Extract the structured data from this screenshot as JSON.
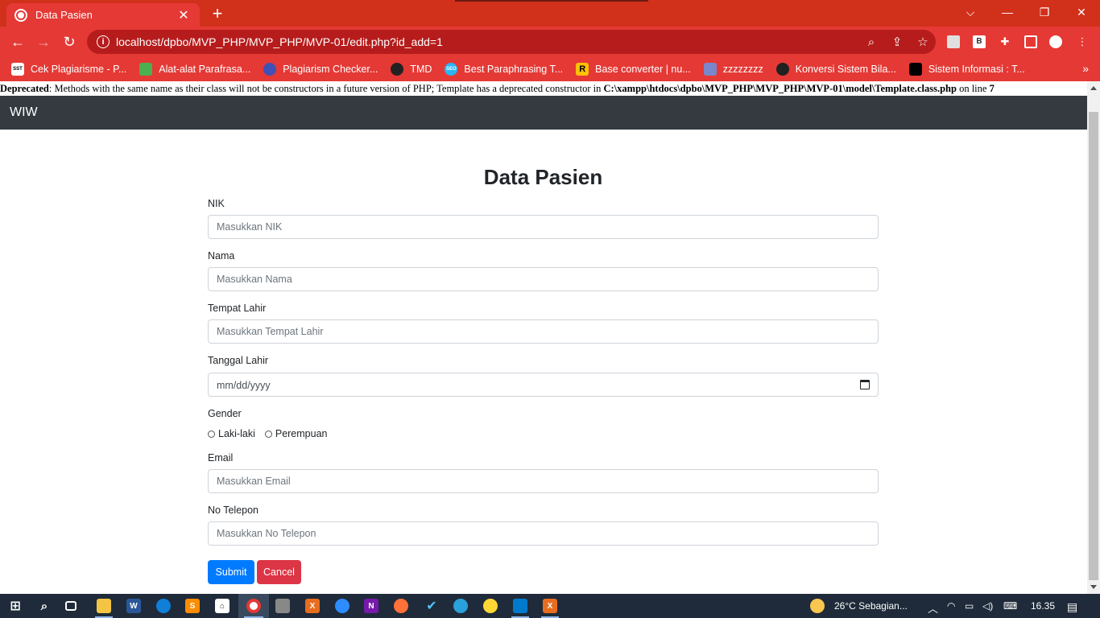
{
  "browser": {
    "tab_title": "Data Pasien",
    "tab_close": "✕",
    "new_tab": "+",
    "window_controls": [
      "⌵",
      "—",
      "❐",
      "✕"
    ],
    "url": "localhost/dpbo/MVP_PHP/MVP_PHP/MVP-01/edit.php?id_add=1",
    "nav": {
      "back": "←",
      "forward": "→",
      "reload": "↻"
    },
    "omnibox_icons": [
      "zoom-icon",
      "share-icon",
      "star-icon"
    ],
    "bookmarks": [
      {
        "label": "Cek Plagiarisme - P...",
        "icon": "SST",
        "color": "#ffffff"
      },
      {
        "label": "Alat-alat Parafrasa...",
        "icon": "",
        "color": "#4caf50"
      },
      {
        "label": "Plagiarism Checker...",
        "icon": "",
        "color": "#3f51b5"
      },
      {
        "label": "TMD",
        "icon": "",
        "color": "#222222"
      },
      {
        "label": "Best Paraphrasing T...",
        "icon": "SEO",
        "color": "#29b6f6"
      },
      {
        "label": "Base converter | nu...",
        "icon": "R",
        "color": "#ffc107"
      },
      {
        "label": "zzzzzzzz",
        "icon": "",
        "color": "#7986cb"
      },
      {
        "label": "Konversi Sistem Bila...",
        "icon": "",
        "color": "#212121"
      },
      {
        "label": "Sistem Informasi : T...",
        "icon": "",
        "color": "#000000"
      }
    ],
    "bookmarks_more": "»"
  },
  "page": {
    "deprecated_label": "Deprecated",
    "deprecated_message": ": Methods with the same name as their class will not be constructors in a future version of PHP; Template has a deprecated constructor in ",
    "deprecated_path": "C:\\xampp\\htdocs\\dpbo\\MVP_PHP\\MVP_PHP\\MVP-01\\model\\Template.class.php",
    "deprecated_online": " on line ",
    "deprecated_line": "7",
    "brand": "WIW",
    "form": {
      "title": "Data Pasien",
      "nik_label": "NIK",
      "nik_placeholder": "Masukkan NIK",
      "nama_label": "Nama",
      "nama_placeholder": "Masukkan Nama",
      "tempat_label": "Tempat Lahir",
      "tempat_placeholder": "Masukkan Tempat Lahir",
      "tanggal_label": "Tanggal Lahir",
      "tanggal_placeholder": "mm/dd/yyyy",
      "gender_label": "Gender",
      "gender_options": [
        "Laki-laki",
        "Perempuan"
      ],
      "email_label": "Email",
      "email_placeholder": "Masukkan Email",
      "telepon_label": "No Telepon",
      "telepon_placeholder": "Masukkan No Telepon",
      "submit_label": "Submit",
      "cancel_label": "Cancel"
    }
  },
  "taskbar": {
    "weather": "26°C  Sebagian...",
    "time": "16.35"
  },
  "colors": {
    "browser_frame": "#d1301b",
    "browser_toolbar": "#e53935",
    "navbar": "#343a40",
    "submit": "#007bff",
    "cancel": "#dc3545",
    "taskbar": "#1f2b3a"
  }
}
